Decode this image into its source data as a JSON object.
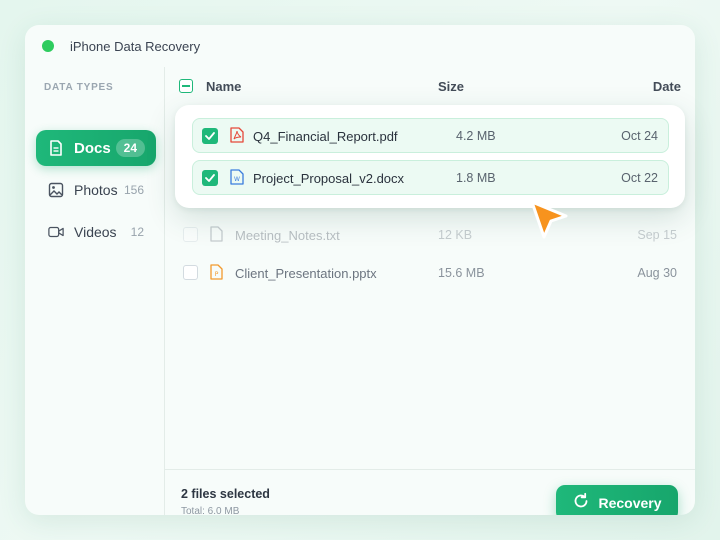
{
  "app": {
    "title": "iPhone Data Recovery"
  },
  "sidebar": {
    "section_label": "DATA TYPES",
    "items": [
      {
        "label": "Docs",
        "count": "24",
        "icon": "document-icon",
        "active": true
      },
      {
        "label": "Photos",
        "count": "156",
        "icon": "image-icon",
        "active": false
      },
      {
        "label": "Videos",
        "count": "12",
        "icon": "video-icon",
        "active": false
      }
    ]
  },
  "table": {
    "headers": {
      "name": "Name",
      "size": "Size",
      "date": "Date"
    },
    "rows": [
      {
        "name": "Q4_Financial_Report.pdf",
        "size": "4.2 MB",
        "date": "Oct 24",
        "type": "pdf",
        "checked": true
      },
      {
        "name": "Project_Proposal_v2.docx",
        "size": "1.8 MB",
        "date": "Oct 22",
        "type": "docx",
        "checked": true
      },
      {
        "name": "Meeting_Notes.txt",
        "size": "12 KB",
        "date": "Sep 15",
        "type": "txt",
        "checked": false
      },
      {
        "name": "Client_Presentation.pptx",
        "size": "15.6 MB",
        "date": "Aug 30",
        "type": "pptx",
        "checked": false
      }
    ]
  },
  "footer": {
    "selected_text": "2 files selected",
    "total_text": "Total: 6.0 MB",
    "recover_label": "Recovery"
  },
  "colors": {
    "accent": "#1fb87a",
    "cursor": "#f7931e",
    "pdf": "#e5493a",
    "docx": "#3b7ddd",
    "pptx": "#f29a2e"
  }
}
